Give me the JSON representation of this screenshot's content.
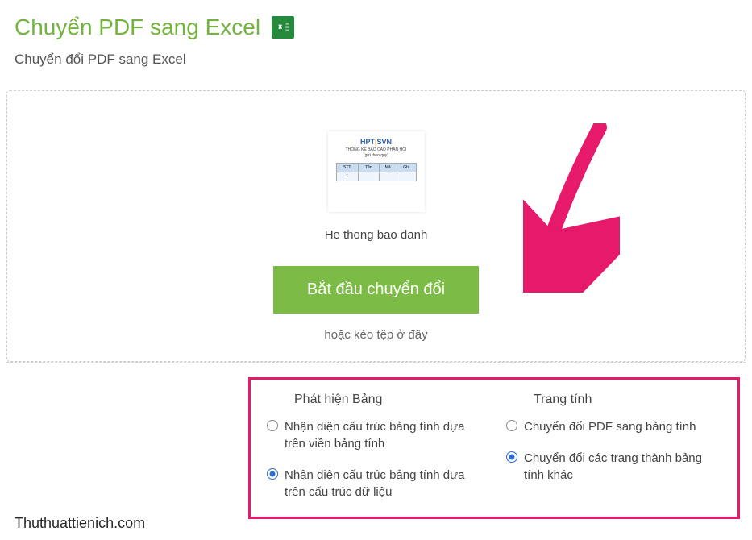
{
  "header": {
    "title": "Chuyển PDF sang Excel",
    "subtitle": "Chuyển đổi PDF sang Excel"
  },
  "dropzone": {
    "filename": "He thong bao danh",
    "convert_label": "Bắt đầu chuyển đổi",
    "drag_hint": "hoặc kéo tệp ở đây"
  },
  "options": {
    "col1": {
      "heading": "Phát hiện Bảng",
      "opt1": {
        "label": "Nhận diện cấu trúc bảng tính dựa trên viền bảng tính",
        "selected": false
      },
      "opt2": {
        "label": "Nhận diện cấu trúc bảng tính dựa trên cấu trúc dữ liệu",
        "selected": true
      }
    },
    "col2": {
      "heading": "Trang tính",
      "opt1": {
        "label": "Chuyển đổi PDF sang bảng tính",
        "selected": false
      },
      "opt2": {
        "label": "Chuyển đổi các trang thành bảng tính khác",
        "selected": true
      }
    }
  },
  "watermark": "Thuthuattienich.com"
}
